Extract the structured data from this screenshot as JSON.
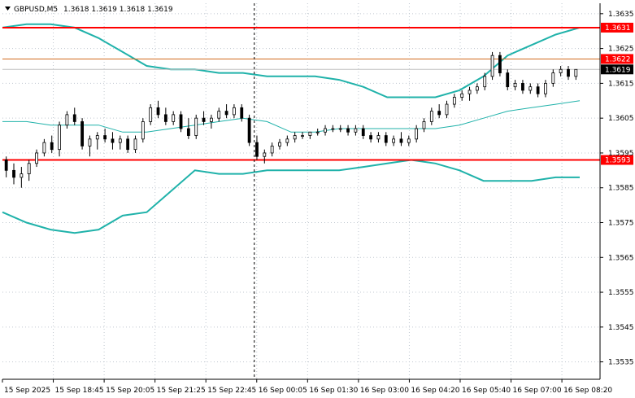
{
  "header": {
    "symbol": "GBPUSD,M5",
    "ohlc": "1.3618 1.3619 1.3618 1.3619"
  },
  "colors": {
    "bollinger": "#20b2aa",
    "support_resistance": "#ff0000",
    "prev_level": "#d2691e",
    "current_price_line": "#c0c0c0",
    "grid": "#c0c8d0",
    "candle": "#000000",
    "label_bg_red": "#ff0000",
    "label_bg_black": "#000000"
  },
  "chart_data": {
    "type": "candlestick",
    "y_range": [
      1.353,
      1.3638
    ],
    "y_ticks": [
      "1.3635",
      "1.3625",
      "1.3615",
      "1.3605",
      "1.3595",
      "1.3585",
      "1.3575",
      "1.3565",
      "1.3555",
      "1.3545",
      "1.3535"
    ],
    "x_labels": [
      "15 Sep 2025",
      "15 Sep 18:45",
      "15 Sep 20:05",
      "15 Sep 21:25",
      "15 Sep 22:45",
      "16 Sep 00:05",
      "16 Sep 01:30",
      "16 Sep 03:00",
      "16 Sep 04:20",
      "16 Sep 05:40",
      "16 Sep 07:00",
      "16 Sep 08:20"
    ],
    "levels": [
      {
        "price": "1.3631",
        "kind": "resistance"
      },
      {
        "price": "1.3622",
        "kind": "previous"
      },
      {
        "price": "1.3619",
        "kind": "current"
      },
      {
        "price": "1.3593",
        "kind": "support"
      }
    ],
    "separator_label": "16 Sep 00:05",
    "candles": [
      [
        1.3593,
        1.3594,
        1.3588,
        1.359
      ],
      [
        1.359,
        1.3592,
        1.3586,
        1.3588
      ],
      [
        1.3588,
        1.3591,
        1.3585,
        1.3589
      ],
      [
        1.3589,
        1.3593,
        1.3587,
        1.3592
      ],
      [
        1.3592,
        1.3596,
        1.3591,
        1.3595
      ],
      [
        1.3595,
        1.3599,
        1.3594,
        1.3598
      ],
      [
        1.3598,
        1.36,
        1.3595,
        1.3596
      ],
      [
        1.3596,
        1.3604,
        1.3594,
        1.3603
      ],
      [
        1.3603,
        1.3607,
        1.3602,
        1.3606
      ],
      [
        1.3606,
        1.3608,
        1.3603,
        1.3604
      ],
      [
        1.3604,
        1.3605,
        1.3596,
        1.3597
      ],
      [
        1.3597,
        1.36,
        1.3594,
        1.3599
      ],
      [
        1.3599,
        1.3601,
        1.3596,
        1.36
      ],
      [
        1.36,
        1.3602,
        1.3598,
        1.3599
      ],
      [
        1.3599,
        1.3601,
        1.3596,
        1.3598
      ],
      [
        1.3598,
        1.36,
        1.3596,
        1.3599
      ],
      [
        1.3599,
        1.36,
        1.3595,
        1.3596
      ],
      [
        1.3596,
        1.36,
        1.3595,
        1.3599
      ],
      [
        1.3599,
        1.3605,
        1.3598,
        1.3604
      ],
      [
        1.3604,
        1.3609,
        1.3603,
        1.3608
      ],
      [
        1.3608,
        1.361,
        1.3605,
        1.3606
      ],
      [
        1.3606,
        1.3608,
        1.3603,
        1.3604
      ],
      [
        1.3604,
        1.3607,
        1.3603,
        1.3606
      ],
      [
        1.3606,
        1.3607,
        1.3601,
        1.3602
      ],
      [
        1.3602,
        1.3605,
        1.3599,
        1.36
      ],
      [
        1.36,
        1.3606,
        1.3599,
        1.3605
      ],
      [
        1.3605,
        1.3607,
        1.3603,
        1.3604
      ],
      [
        1.3604,
        1.3606,
        1.3602,
        1.3605
      ],
      [
        1.3605,
        1.3608,
        1.3604,
        1.3607
      ],
      [
        1.3607,
        1.3609,
        1.3605,
        1.3606
      ],
      [
        1.3606,
        1.3609,
        1.3605,
        1.3608
      ],
      [
        1.3608,
        1.3609,
        1.3604,
        1.3605
      ],
      [
        1.3605,
        1.3606,
        1.3597,
        1.3598
      ],
      [
        1.3598,
        1.36,
        1.3593,
        1.3594
      ],
      [
        1.3594,
        1.3596,
        1.3592,
        1.3595
      ],
      [
        1.3595,
        1.3598,
        1.3594,
        1.3597
      ],
      [
        1.3597,
        1.3599,
        1.3596,
        1.3598
      ],
      [
        1.3598,
        1.36,
        1.3597,
        1.3599
      ],
      [
        1.3599,
        1.3601,
        1.3598,
        1.36
      ],
      [
        1.36,
        1.3601,
        1.3599,
        1.36
      ],
      [
        1.36,
        1.3601,
        1.3599,
        1.3601
      ],
      [
        1.3601,
        1.3602,
        1.36,
        1.3601
      ],
      [
        1.3601,
        1.3603,
        1.36,
        1.3602
      ],
      [
        1.3602,
        1.3603,
        1.3601,
        1.3602
      ],
      [
        1.3602,
        1.3603,
        1.3601,
        1.3602
      ],
      [
        1.3602,
        1.3603,
        1.36,
        1.3601
      ],
      [
        1.3601,
        1.3603,
        1.36,
        1.3602
      ],
      [
        1.3602,
        1.3603,
        1.3599,
        1.36
      ],
      [
        1.36,
        1.3601,
        1.3598,
        1.3599
      ],
      [
        1.3599,
        1.3601,
        1.3598,
        1.36
      ],
      [
        1.36,
        1.3601,
        1.3597,
        1.3598
      ],
      [
        1.3598,
        1.36,
        1.3597,
        1.3599
      ],
      [
        1.3599,
        1.3601,
        1.3597,
        1.3598
      ],
      [
        1.3598,
        1.36,
        1.3597,
        1.3599
      ],
      [
        1.3599,
        1.3603,
        1.3598,
        1.3602
      ],
      [
        1.3602,
        1.3605,
        1.3601,
        1.3604
      ],
      [
        1.3604,
        1.3608,
        1.3603,
        1.3607
      ],
      [
        1.3607,
        1.3609,
        1.3605,
        1.3606
      ],
      [
        1.3606,
        1.361,
        1.3605,
        1.3609
      ],
      [
        1.3609,
        1.3612,
        1.3608,
        1.3611
      ],
      [
        1.3611,
        1.3613,
        1.361,
        1.3612
      ],
      [
        1.3612,
        1.3614,
        1.361,
        1.3613
      ],
      [
        1.3613,
        1.3615,
        1.3612,
        1.3614
      ],
      [
        1.3614,
        1.3618,
        1.3613,
        1.3617
      ],
      [
        1.3617,
        1.3624,
        1.3616,
        1.3623
      ],
      [
        1.3623,
        1.3624,
        1.3617,
        1.3618
      ],
      [
        1.3618,
        1.3619,
        1.3613,
        1.3614
      ],
      [
        1.3614,
        1.3616,
        1.3613,
        1.3615
      ],
      [
        1.3615,
        1.3616,
        1.3612,
        1.3613
      ],
      [
        1.3613,
        1.3615,
        1.3612,
        1.3614
      ],
      [
        1.3614,
        1.3615,
        1.3611,
        1.3612
      ],
      [
        1.3612,
        1.3616,
        1.3611,
        1.3615
      ],
      [
        1.3615,
        1.3619,
        1.3614,
        1.3618
      ],
      [
        1.3618,
        1.362,
        1.3617,
        1.3619
      ],
      [
        1.3619,
        1.362,
        1.3616,
        1.3617
      ],
      [
        1.3617,
        1.3619,
        1.3616,
        1.3619
      ]
    ],
    "bollinger": {
      "upper": [
        1.3631,
        1.3632,
        1.3632,
        1.3631,
        1.3628,
        1.3624,
        1.362,
        1.3619,
        1.3619,
        1.3618,
        1.3618,
        1.3617,
        1.3617,
        1.3617,
        1.3616,
        1.3614,
        1.3611,
        1.3611,
        1.3611,
        1.3613,
        1.3617,
        1.3623,
        1.3626,
        1.3629,
        1.3631
      ],
      "middle": [
        1.3604,
        1.3604,
        1.3603,
        1.3603,
        1.3603,
        1.3601,
        1.3601,
        1.3602,
        1.3603,
        1.3604,
        1.3605,
        1.3604,
        1.3601,
        1.3601,
        1.3602,
        1.3602,
        1.3602,
        1.3602,
        1.3602,
        1.3603,
        1.3605,
        1.3607,
        1.3608,
        1.3609,
        1.361
      ],
      "lower": [
        1.3578,
        1.3575,
        1.3573,
        1.3572,
        1.3573,
        1.3577,
        1.3578,
        1.3584,
        1.359,
        1.3589,
        1.3589,
        1.359,
        1.359,
        1.359,
        1.359,
        1.3591,
        1.3592,
        1.3593,
        1.3592,
        1.359,
        1.3587,
        1.3587,
        1.3587,
        1.3588,
        1.3588
      ]
    },
    "grid": true
  }
}
